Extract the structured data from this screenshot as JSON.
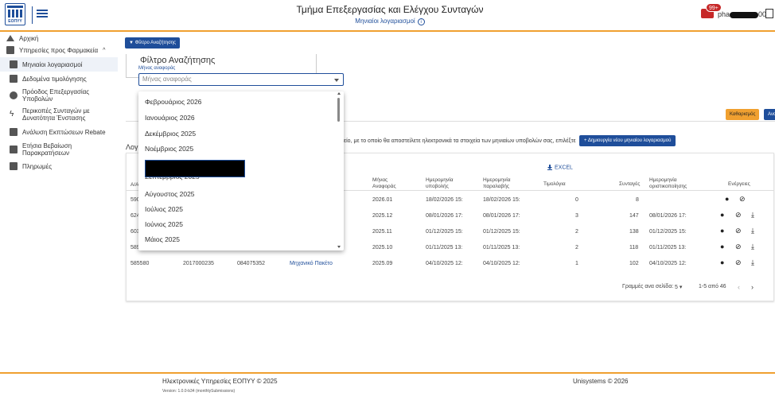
{
  "header": {
    "logo_text": "ΕΟΠΥΥ",
    "title": "Τμήμα Επεξεργασίας και Ελέγχου Συνταγών",
    "subtitle": "Μηνιαίοι λογαριασμοί",
    "notification_count": "99+",
    "user": "pha",
    "user_suffix": "00"
  },
  "sidebar": {
    "items": [
      {
        "label": "Αρχική"
      },
      {
        "label": "Υπηρεσίες προς Φαρμακεία"
      },
      {
        "label": "Μηνιαίοι λογαριασμοί"
      },
      {
        "label": "Δεδομένα τιμολόγησης"
      },
      {
        "label": "Πρόοδος Επεξεργασίας Υποβολών"
      },
      {
        "label": "Περικοπές Συνταγών με Δυνατότητα Ένστασης"
      },
      {
        "label": "Ανάλυση Εκπτώσεων Rebate"
      },
      {
        "label": "Ετήσια Βεβαίωση Παρακρατήσεων"
      },
      {
        "label": "Πληρωμές"
      }
    ]
  },
  "filter": {
    "toggle_label": "Φίλτρο Αναζήτησης",
    "legend": "Φίλτρο Αναζήτησης",
    "field_label": "Μήνας αναφοράς",
    "placeholder": "Μήνας αναφοράς",
    "clear_label": "Καθαρισμός",
    "search_label": "Αναζήτηση"
  },
  "dropdown": {
    "options": [
      "Φεβρουάριος 2026",
      "Ιανουάριος 2026",
      "Δεκέμβριος 2025",
      "Νοέμβριος 2025",
      "Σεπτέμβριος 2025",
      "Αύγουστος 2025",
      "Ιούλιος 2025",
      "Ιούνιος 2025",
      "Μάιος 2025"
    ]
  },
  "notice": {
    "text": "είο, με το οποίο θα αποστείλετε ηλεκτρονικά τα στοιχεία των μηνιαίων υποβολών σας, επιλέξτε",
    "create_label": "Δημιουργία νέου μηνιαίου λογαριασμού"
  },
  "table": {
    "title_fragment": "Λογ",
    "excel_label": "EXCEL",
    "headers": {
      "id": "Α/Α",
      "month": "Μήνας Αναφοράς",
      "submitted": "Ημερομηνία υποβολής",
      "received": "Ημερομηνία παραλαβής",
      "invoices": "Τιμολόγια",
      "prescriptions": "Συνταγές",
      "finalized": "Ημερομηνία οριστικοποίησης",
      "actions": "Ενέργειες"
    },
    "rows": [
      {
        "id": "590",
        "month": "2026.01",
        "submitted": "18/02/2026 15:",
        "received": "18/02/2026 15:",
        "invoices": "0",
        "prescriptions": "8",
        "finalized": ""
      },
      {
        "id": "624",
        "month": "2025.12",
        "submitted": "08/01/2026 17:",
        "received": "08/01/2026 17:",
        "invoices": "3",
        "prescriptions": "147",
        "finalized": "08/01/2026 17:"
      },
      {
        "id": "603",
        "month": "2025.11",
        "submitted": "01/12/2025 15:",
        "received": "01/12/2025 15:",
        "invoices": "2",
        "prescriptions": "138",
        "finalized": "01/12/2025 15:"
      },
      {
        "id": "589",
        "month": "2025.10",
        "submitted": "01/11/2025 13:",
        "received": "01/11/2025 13:",
        "invoices": "2",
        "prescriptions": "118",
        "finalized": "01/11/2025 13:"
      },
      {
        "id": "585580",
        "code1": "2017000235",
        "code2": "084075352",
        "type": "Μηχανικό Πακέτο",
        "month": "2025.09",
        "submitted": "04/10/2025 12:",
        "received": "04/10/2025 12:",
        "invoices": "1",
        "prescriptions": "102",
        "finalized": "04/10/2025 12:"
      }
    ],
    "pager": {
      "rows_label": "Γραμμές ανα σελίδα:",
      "rows_value": "5",
      "range": "1-5 από 46"
    }
  },
  "footer": {
    "left": "Ηλεκτρονικές Υπηρεσίες ΕΟΠΥΥ © 2025",
    "version": "Version: 1.0.0-b34 (monthlySubmissions)",
    "right": "Unisystems © 2026"
  }
}
